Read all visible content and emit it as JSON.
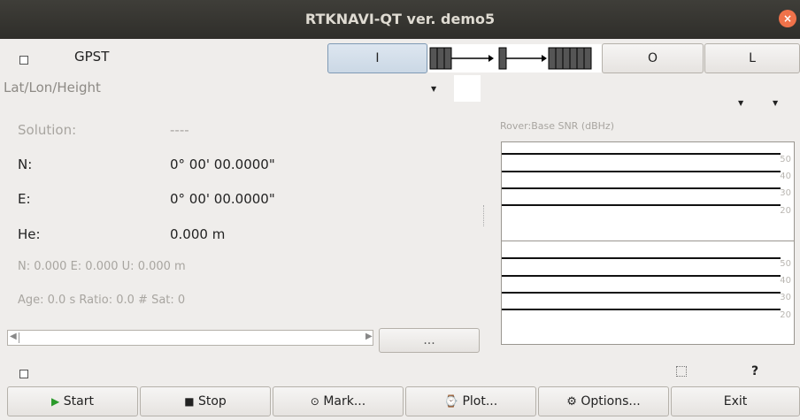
{
  "window": {
    "title": "RTKNAVI-QT ver. demo5",
    "close_glyph": "×"
  },
  "toolbar": {
    "time_sys": "GPST",
    "stream_btn_i": "I",
    "stream_btn_o": "O",
    "stream_btn_l": "L"
  },
  "solution": {
    "format": "Lat/Lon/Height",
    "status_label": "Solution:",
    "status_value": "----",
    "n_label": "N:",
    "n_value": "0° 00' 00.0000\"",
    "e_label": "E:",
    "e_value": "0° 00' 00.0000\"",
    "h_label": "He:",
    "h_value": "0.000 m",
    "neu": "N: 0.000 E: 0.000 U: 0.000 m",
    "age": "Age: 0.0 s Ratio: 0.0 # Sat: 0"
  },
  "scroll": {
    "more": "...",
    "left_glyph": "◀",
    "right_glyph": "▶"
  },
  "plot": {
    "title": "Rover:Base SNR (dBHz)",
    "ticks": [
      "50",
      "40",
      "30",
      "20"
    ]
  },
  "bottom": {
    "help": "?"
  },
  "buttons": {
    "start": "Start",
    "stop": "Stop",
    "mark": "Mark...",
    "plot": "Plot...",
    "options": "Options...",
    "exit": "Exit"
  },
  "icons": {
    "start": "play-icon",
    "stop": "stop-icon",
    "mark": "mark-icon",
    "plot": "plot-icon",
    "options": "gear-icon"
  }
}
